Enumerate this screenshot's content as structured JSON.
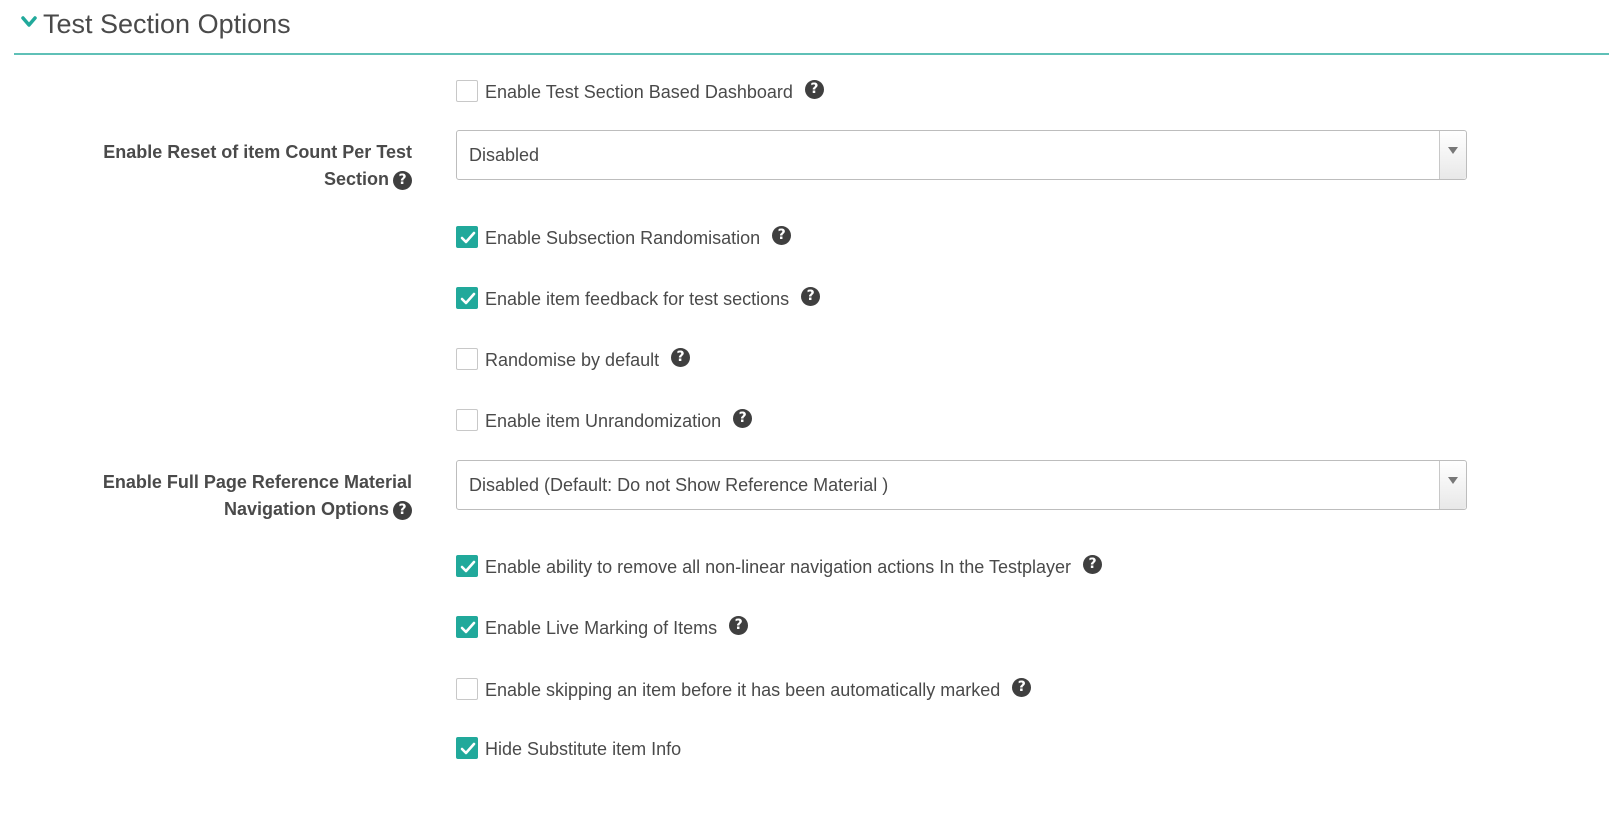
{
  "section": {
    "title": "Test Section Options"
  },
  "fields": {
    "dashboard": {
      "label": "Enable Test Section Based Dashboard",
      "checked": false
    },
    "reset_item_count": {
      "label_line1": "Enable Reset of item Count Per Test",
      "label_line2": "Section",
      "value": "Disabled"
    },
    "subsection_randomisation": {
      "label": "Enable Subsection Randomisation",
      "checked": true
    },
    "item_feedback": {
      "label": "Enable item feedback for test sections",
      "checked": true
    },
    "randomise_default": {
      "label": "Randomise by default",
      "checked": false
    },
    "item_unrandomization": {
      "label": "Enable item Unrandomization",
      "checked": false
    },
    "reference_material_nav": {
      "label_line1": "Enable Full Page Reference Material",
      "label_line2": "Navigation Options",
      "value": "Disabled (Default: Do not Show Reference Material )"
    },
    "remove_nonlinear_nav": {
      "label": "Enable ability to remove all non-linear navigation actions In the Testplayer",
      "checked": true
    },
    "live_marking": {
      "label": "Enable Live Marking of Items",
      "checked": true
    },
    "skip_before_marked": {
      "label": "Enable skipping an item before it has been automatically marked",
      "checked": false
    },
    "hide_substitute_info": {
      "label": "Hide Substitute item Info",
      "checked": true
    }
  },
  "help_glyph": "?",
  "colors": {
    "accent": "#21a99b",
    "divider": "#5fc0b7",
    "text": "#4a4a4a",
    "help_icon": "#3f3f3f"
  }
}
